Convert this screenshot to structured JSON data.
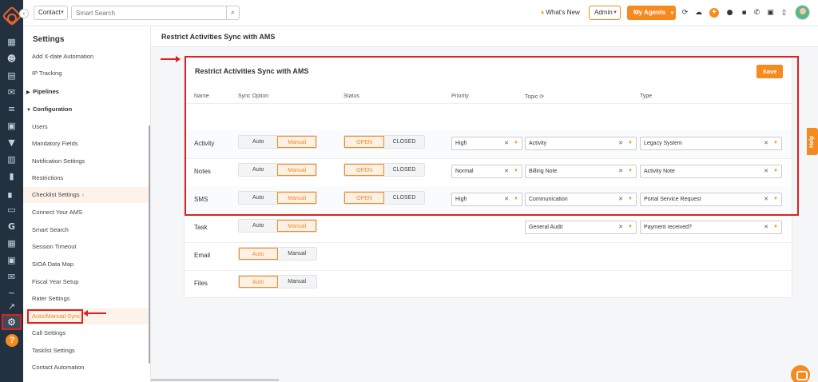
{
  "topbar": {
    "contact_label": "Contact",
    "search_placeholder": "Smart Search",
    "whats_new": "What's New",
    "admin_label": "Admin",
    "my_agents_label": "My Agents"
  },
  "rail": {
    "icons": [
      "dashboard-icon",
      "contacts-icon",
      "documents-icon",
      "mail-icon",
      "list-icon",
      "calendar-icon",
      "filter-icon",
      "tasks-icon",
      "book-icon",
      "chart-icon",
      "folder-icon",
      "google-icon",
      "table-icon",
      "calendar-small-icon",
      "envelope-icon",
      "activity-icon",
      "trend-icon",
      "settings-icon",
      "help-icon"
    ]
  },
  "sidebar": {
    "title": "Settings",
    "items": [
      {
        "label": "Add X-date Automation",
        "type": "item"
      },
      {
        "label": "IP Tracking",
        "type": "item"
      },
      {
        "label": "Pipelines",
        "type": "section",
        "expanded": false
      },
      {
        "label": "Configuration",
        "type": "section",
        "expanded": true
      },
      {
        "label": "Users",
        "type": "item"
      },
      {
        "label": "Mandatory Fields",
        "type": "item"
      },
      {
        "label": "Notification Settings",
        "type": "item"
      },
      {
        "label": "Restrictions",
        "type": "item"
      },
      {
        "label": "Checklist Settings",
        "type": "item",
        "highlight": true,
        "chevron": "›"
      },
      {
        "label": "Connect Your AMS",
        "type": "item"
      },
      {
        "label": "Smart Search",
        "type": "item"
      },
      {
        "label": "Session Timeout",
        "type": "item"
      },
      {
        "label": "SIOA Data Map",
        "type": "item"
      },
      {
        "label": "Fiscal Year Setup",
        "type": "item"
      },
      {
        "label": "Rater Settings",
        "type": "item"
      },
      {
        "label": "Auto/Manual Sync",
        "type": "item",
        "active": true
      },
      {
        "label": "Call Settings",
        "type": "item"
      },
      {
        "label": "Tasklist Settings",
        "type": "item"
      },
      {
        "label": "Contact Automation",
        "type": "item"
      }
    ]
  },
  "main": {
    "page_title": "Restrict Activities Sync with AMS",
    "card_title": "Restrict Activities Sync with AMS",
    "save_label": "Save",
    "headers": {
      "name": "Name",
      "sync": "Sync Option",
      "status": "Status",
      "priority": "Priority",
      "topic": "Topic",
      "type": "Type"
    },
    "sync_labels": {
      "auto": "Auto",
      "manual": "Manual"
    },
    "status_labels": {
      "open": "OPEN",
      "closed": "CLOSED"
    },
    "rows": [
      {
        "name": "Activity",
        "sync": "Manual",
        "status": "OPEN",
        "priority": "High",
        "topic": "Activity",
        "type": "Legacy System"
      },
      {
        "name": "Notes",
        "sync": "Manual",
        "status": "OPEN",
        "priority": "Normal",
        "topic": "Billing Note",
        "type": "Activity Note"
      },
      {
        "name": "SMS",
        "sync": "Manual",
        "status": "OPEN",
        "priority": "High",
        "topic": "Communication",
        "type": "Portal Service Request"
      },
      {
        "name": "Task",
        "sync": "Manual",
        "status": null,
        "priority": null,
        "topic": "General Audit",
        "type": "Payment received?"
      },
      {
        "name": "Email",
        "sync": "Auto",
        "status": null,
        "priority": null,
        "topic": null,
        "type": null
      },
      {
        "name": "Files",
        "sync": "Auto",
        "status": null,
        "priority": null,
        "topic": null,
        "type": null
      }
    ]
  },
  "floating": {
    "help_label": "Help"
  },
  "colors": {
    "accent": "#f58a1f",
    "highlight_border": "#e02020",
    "rail": "#22313f"
  }
}
